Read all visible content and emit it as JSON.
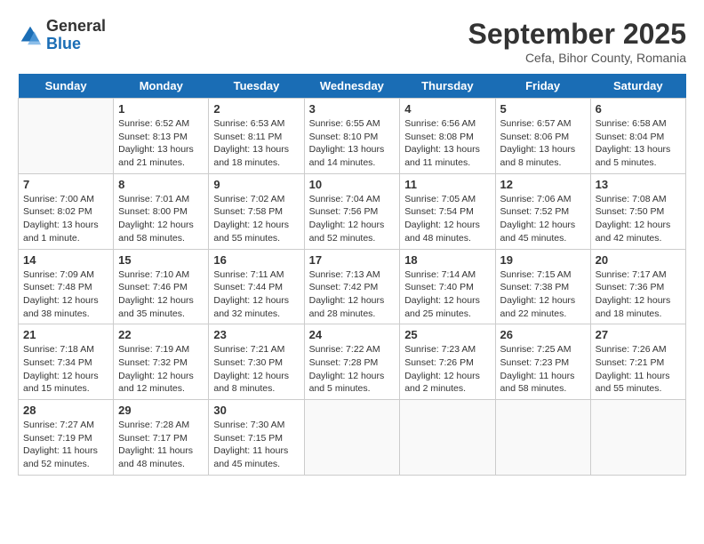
{
  "logo": {
    "general": "General",
    "blue": "Blue"
  },
  "header": {
    "month": "September 2025",
    "location": "Cefa, Bihor County, Romania"
  },
  "days_of_week": [
    "Sunday",
    "Monday",
    "Tuesday",
    "Wednesday",
    "Thursday",
    "Friday",
    "Saturday"
  ],
  "weeks": [
    [
      {
        "day": "",
        "info": ""
      },
      {
        "day": "1",
        "info": "Sunrise: 6:52 AM\nSunset: 8:13 PM\nDaylight: 13 hours\nand 21 minutes."
      },
      {
        "day": "2",
        "info": "Sunrise: 6:53 AM\nSunset: 8:11 PM\nDaylight: 13 hours\nand 18 minutes."
      },
      {
        "day": "3",
        "info": "Sunrise: 6:55 AM\nSunset: 8:10 PM\nDaylight: 13 hours\nand 14 minutes."
      },
      {
        "day": "4",
        "info": "Sunrise: 6:56 AM\nSunset: 8:08 PM\nDaylight: 13 hours\nand 11 minutes."
      },
      {
        "day": "5",
        "info": "Sunrise: 6:57 AM\nSunset: 8:06 PM\nDaylight: 13 hours\nand 8 minutes."
      },
      {
        "day": "6",
        "info": "Sunrise: 6:58 AM\nSunset: 8:04 PM\nDaylight: 13 hours\nand 5 minutes."
      }
    ],
    [
      {
        "day": "7",
        "info": "Sunrise: 7:00 AM\nSunset: 8:02 PM\nDaylight: 13 hours\nand 1 minute."
      },
      {
        "day": "8",
        "info": "Sunrise: 7:01 AM\nSunset: 8:00 PM\nDaylight: 12 hours\nand 58 minutes."
      },
      {
        "day": "9",
        "info": "Sunrise: 7:02 AM\nSunset: 7:58 PM\nDaylight: 12 hours\nand 55 minutes."
      },
      {
        "day": "10",
        "info": "Sunrise: 7:04 AM\nSunset: 7:56 PM\nDaylight: 12 hours\nand 52 minutes."
      },
      {
        "day": "11",
        "info": "Sunrise: 7:05 AM\nSunset: 7:54 PM\nDaylight: 12 hours\nand 48 minutes."
      },
      {
        "day": "12",
        "info": "Sunrise: 7:06 AM\nSunset: 7:52 PM\nDaylight: 12 hours\nand 45 minutes."
      },
      {
        "day": "13",
        "info": "Sunrise: 7:08 AM\nSunset: 7:50 PM\nDaylight: 12 hours\nand 42 minutes."
      }
    ],
    [
      {
        "day": "14",
        "info": "Sunrise: 7:09 AM\nSunset: 7:48 PM\nDaylight: 12 hours\nand 38 minutes."
      },
      {
        "day": "15",
        "info": "Sunrise: 7:10 AM\nSunset: 7:46 PM\nDaylight: 12 hours\nand 35 minutes."
      },
      {
        "day": "16",
        "info": "Sunrise: 7:11 AM\nSunset: 7:44 PM\nDaylight: 12 hours\nand 32 minutes."
      },
      {
        "day": "17",
        "info": "Sunrise: 7:13 AM\nSunset: 7:42 PM\nDaylight: 12 hours\nand 28 minutes."
      },
      {
        "day": "18",
        "info": "Sunrise: 7:14 AM\nSunset: 7:40 PM\nDaylight: 12 hours\nand 25 minutes."
      },
      {
        "day": "19",
        "info": "Sunrise: 7:15 AM\nSunset: 7:38 PM\nDaylight: 12 hours\nand 22 minutes."
      },
      {
        "day": "20",
        "info": "Sunrise: 7:17 AM\nSunset: 7:36 PM\nDaylight: 12 hours\nand 18 minutes."
      }
    ],
    [
      {
        "day": "21",
        "info": "Sunrise: 7:18 AM\nSunset: 7:34 PM\nDaylight: 12 hours\nand 15 minutes."
      },
      {
        "day": "22",
        "info": "Sunrise: 7:19 AM\nSunset: 7:32 PM\nDaylight: 12 hours\nand 12 minutes."
      },
      {
        "day": "23",
        "info": "Sunrise: 7:21 AM\nSunset: 7:30 PM\nDaylight: 12 hours\nand 8 minutes."
      },
      {
        "day": "24",
        "info": "Sunrise: 7:22 AM\nSunset: 7:28 PM\nDaylight: 12 hours\nand 5 minutes."
      },
      {
        "day": "25",
        "info": "Sunrise: 7:23 AM\nSunset: 7:26 PM\nDaylight: 12 hours\nand 2 minutes."
      },
      {
        "day": "26",
        "info": "Sunrise: 7:25 AM\nSunset: 7:23 PM\nDaylight: 11 hours\nand 58 minutes."
      },
      {
        "day": "27",
        "info": "Sunrise: 7:26 AM\nSunset: 7:21 PM\nDaylight: 11 hours\nand 55 minutes."
      }
    ],
    [
      {
        "day": "28",
        "info": "Sunrise: 7:27 AM\nSunset: 7:19 PM\nDaylight: 11 hours\nand 52 minutes."
      },
      {
        "day": "29",
        "info": "Sunrise: 7:28 AM\nSunset: 7:17 PM\nDaylight: 11 hours\nand 48 minutes."
      },
      {
        "day": "30",
        "info": "Sunrise: 7:30 AM\nSunset: 7:15 PM\nDaylight: 11 hours\nand 45 minutes."
      },
      {
        "day": "",
        "info": ""
      },
      {
        "day": "",
        "info": ""
      },
      {
        "day": "",
        "info": ""
      },
      {
        "day": "",
        "info": ""
      }
    ]
  ]
}
